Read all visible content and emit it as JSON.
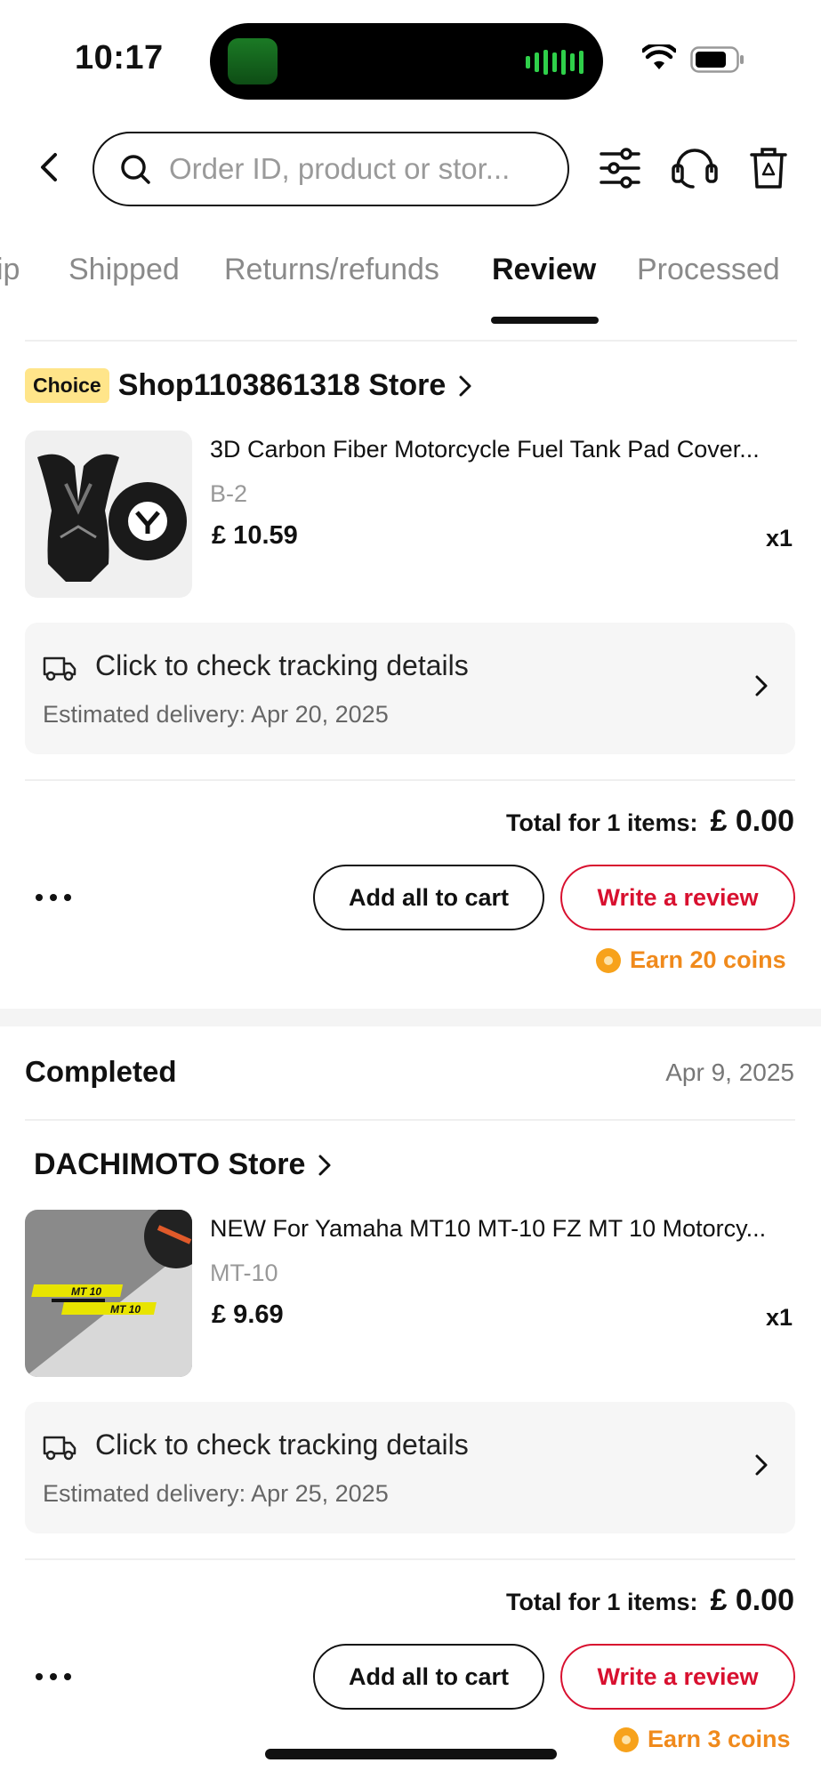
{
  "status_bar": {
    "time": "10:17"
  },
  "search": {
    "placeholder": "Order ID, product or stor..."
  },
  "tabs": [
    {
      "label": "ip"
    },
    {
      "label": "Shipped"
    },
    {
      "label": "Returns/refunds"
    },
    {
      "label": "Review",
      "active": true
    },
    {
      "label": "Processed"
    }
  ],
  "orders": [
    {
      "badge": "Choice",
      "store": "Shop1103861318 Store",
      "product_title": "3D Carbon Fiber Motorcycle Fuel Tank Pad Cover...",
      "variant": "B-2",
      "price": "£ 10.59",
      "qty": "x1",
      "tracking_title": "Click to check tracking details",
      "tracking_eta": "Estimated delivery: Apr 20, 2025",
      "total_label": "Total for 1 items:",
      "total_value": "£ 0.00",
      "add_cart": "Add all to cart",
      "write_review": "Write a review",
      "coins": "Earn 20 coins"
    },
    {
      "status": "Completed",
      "date": "Apr 9, 2025",
      "store": "DACHIMOTO Store",
      "product_title": "NEW For Yamaha MT10 MT-10 FZ MT 10 Motorcy...",
      "variant": "MT-10",
      "price": "£ 9.69",
      "qty": "x1",
      "tracking_title": "Click to check tracking details",
      "tracking_eta": "Estimated delivery: Apr 25, 2025",
      "total_label": "Total for 1 items:",
      "total_value": "£ 0.00",
      "add_cart": "Add all to cart",
      "write_review": "Write a review",
      "coins": "Earn 3 coins",
      "thumb_text": "MT 10"
    }
  ],
  "colors": {
    "accent_red": "#d8102f",
    "coin_orange": "#f08a1c",
    "choice_yellow": "#ffe58a"
  }
}
